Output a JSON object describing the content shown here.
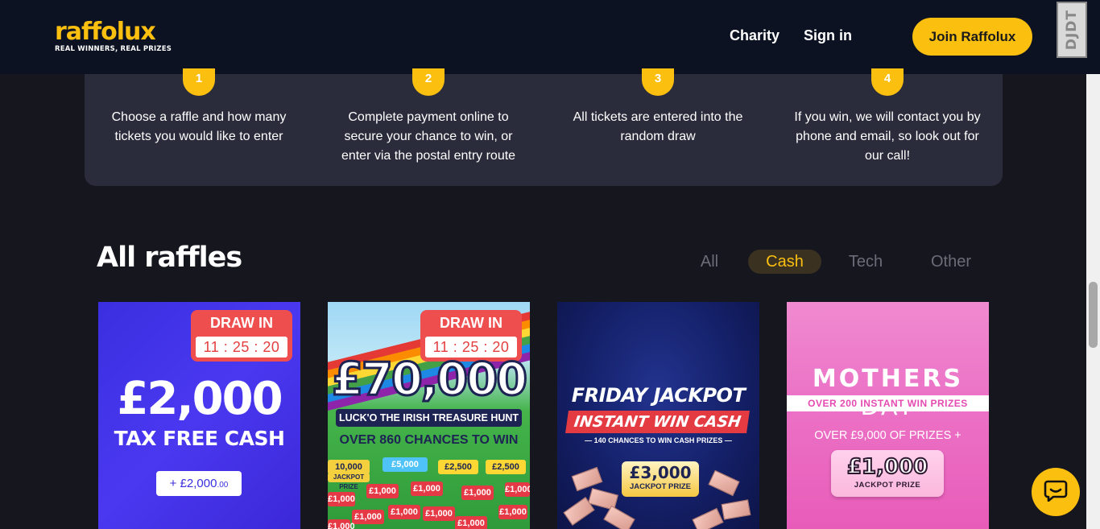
{
  "header": {
    "logo_text": "raffolux",
    "logo_tagline": "REAL WINNERS, REAL PRIZES",
    "nav": [
      "Charity",
      "Sign in"
    ],
    "cta": "Join Raffolux",
    "extension_badge": "DJDT"
  },
  "how_it_works": {
    "steps": [
      {
        "num": "1",
        "text": "Choose a raffle and how many tickets you would like to enter"
      },
      {
        "num": "2",
        "text": "Complete payment online to secure your chance to win, or enter via the postal entry route"
      },
      {
        "num": "3",
        "text": "All tickets are entered into the random draw"
      },
      {
        "num": "4",
        "text": "If you win, we will contact you by phone and email, so look out for our call!"
      }
    ]
  },
  "raffles": {
    "title": "All raffles",
    "filters": [
      "All",
      "Cash",
      "Tech",
      "Other"
    ],
    "active_filter": "Cash",
    "cards": [
      {
        "badge_title": "DRAW IN",
        "countdown": "11 : 25 : 20",
        "amount": "£2,000",
        "subtitle": "TAX FREE CASH",
        "pill_prefix": "+ ",
        "pill_value": "£2,000",
        "pill_pence": ".00"
      },
      {
        "badge_title": "DRAW IN",
        "countdown": "11 : 25 : 20",
        "amount": "£70,000",
        "banner": "LUCK'O THE IRISH TREASURE HUNT",
        "chances": "OVER 860 CHANCES TO WIN",
        "tickets": [
          "10,000",
          "£5,000",
          "£2,500",
          "£2,500",
          "JACKPOT PRIZE",
          "£1,000",
          "£1,000",
          "£1,000",
          "£1,000",
          "£1,000",
          "£1,000",
          "£1,000",
          "£1,000",
          "£1,000",
          "£1,000",
          "£1,000"
        ]
      },
      {
        "title": "FRIDAY JACKPOT",
        "banner": "INSTANT WIN CASH",
        "sub": "— 140 CHANCES TO WIN CASH PRIZES —",
        "prize_amount": "£3,000",
        "prize_label": "JACKPOT PRIZE"
      },
      {
        "title_bold": "MOTHERS",
        "title_light": "DAY",
        "bar": "OVER 200 INSTANT WIN PRIZES",
        "sub": "OVER £9,000 OF PRIZES +",
        "prize_amount": "£1,000",
        "prize_label": "JACKPOT PRIZE"
      }
    ]
  },
  "colors": {
    "brand_yellow": "#fbbf10",
    "header_bg": "#0c1222",
    "page_bg": "#16161e",
    "panel_bg": "#2a2b3b",
    "badge_red": "#ef4e4e"
  },
  "icons": {
    "chat": "chat-bubble-icon"
  }
}
